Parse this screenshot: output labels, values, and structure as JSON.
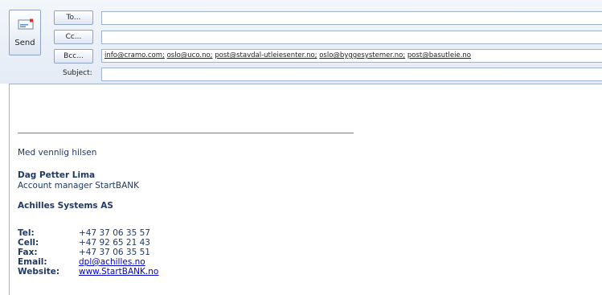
{
  "compose": {
    "send_label": "Send",
    "to_label": "To...",
    "cc_label": "Cc...",
    "bcc_label": "Bcc...",
    "subject_label": "Subject:",
    "to_value": "",
    "cc_value": "",
    "subject_value": "",
    "bcc_recipients": [
      "info@cramo.com;",
      "oslo@uco.no;",
      "post@stavdal-utleiesenter.no;",
      "oslo@byggesystemer.no;",
      "post@basutleie.no"
    ]
  },
  "signature": {
    "greeting": "Med vennlig hilsen",
    "name": "Dag Petter Lima",
    "title": "Account manager StartBANK",
    "company": "Achilles Systems AS",
    "contacts": [
      {
        "label": "Tel:",
        "value": "+47 37 06 35 57"
      },
      {
        "label": "Cell:",
        "value": "+47 92 65 21 43"
      },
      {
        "label": "Fax:",
        "value": "+47 37 06 35 51"
      },
      {
        "label": "Email:",
        "value": "dpl@achilles.no"
      },
      {
        "label": "Website:",
        "value": "www.StartBANK.no"
      }
    ]
  },
  "colors": {
    "header_bg": "#e4ebf5",
    "signature_text": "#1f3864",
    "link": "#0000cc"
  }
}
